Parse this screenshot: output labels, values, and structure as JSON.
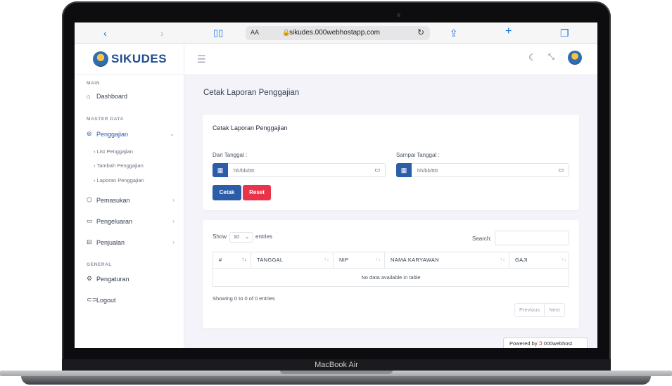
{
  "device": {
    "label": "MacBook Air"
  },
  "browser": {
    "back_icon": "chevron-left-icon",
    "forward_icon": "chevron-right-icon",
    "text_size": "AA",
    "url": "sikudes.000webhostapp.com"
  },
  "app": {
    "logo_text": "SIKUDES"
  },
  "sidebar": {
    "sections": {
      "main": "MAIN",
      "master": "MASTER DATA",
      "general": "GENERAL"
    },
    "items": {
      "dashboard": "Dashboard",
      "penggajian": "Penggajian",
      "pemasukan": "Pemasukan",
      "pengeluaran": "Pengeluaran",
      "penjualan": "Penjualan",
      "pengaturan": "Pengaturan",
      "logout": "Logout"
    },
    "sub_items": {
      "list": "List Penggajian",
      "tambah": "Tambah Penggajian",
      "laporan": "Laporan Penggajian"
    }
  },
  "page": {
    "title": "Cetak Laporan Penggajian"
  },
  "form": {
    "card_title": "Cetak Laporan Penggajian",
    "from_label": "Dari Tanggal :",
    "to_label": "Sampai Tanggal :",
    "date_placeholder": "hh/bb/tttt",
    "print_button": "Cetak",
    "reset_button": "Reset"
  },
  "datatable": {
    "show_label": "Show",
    "length_value": "10",
    "entries_label": "entries",
    "search_label": "Search:",
    "columns": [
      "#",
      "TANGGAL",
      "NIP",
      "NAMA KARYAWAN",
      "GAJI"
    ],
    "empty": "No data available in table",
    "info": "Showing 0 to 0 of 0 entries",
    "previous": "Previous",
    "next": "Next"
  },
  "footer": {
    "powered_by": "Powered by",
    "brand": "000webhost"
  },
  "colors": {
    "primary": "#2b5da8",
    "danger": "#e8334a",
    "background": "#f3f3f9"
  }
}
